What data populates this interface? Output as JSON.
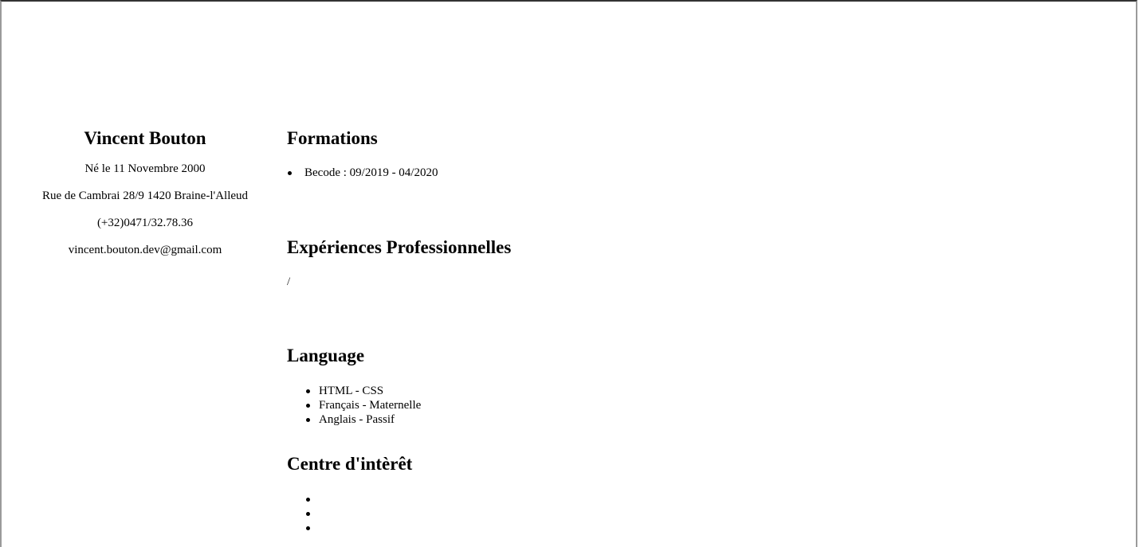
{
  "profile": {
    "name": "Vincent Bouton",
    "birth": "Né le 11 Novembre 2000",
    "address": "Rue de Cambrai 28/9 1420 Braine-l'Alleud",
    "phone": "(+32)0471/32.78.36",
    "email": "vincent.bouton.dev@gmail.com"
  },
  "formations": {
    "title": "Formations",
    "items": [
      "Becode : 09/2019 - 04/2020"
    ]
  },
  "experiences": {
    "title": "Expériences Professionnelles",
    "text": "/"
  },
  "language": {
    "title": "Language",
    "items": [
      "HTML - CSS",
      "Français - Maternelle",
      "Anglais - Passif"
    ]
  },
  "interets": {
    "title": "Centre d'intèrêt",
    "items": [
      "",
      "",
      ""
    ]
  }
}
